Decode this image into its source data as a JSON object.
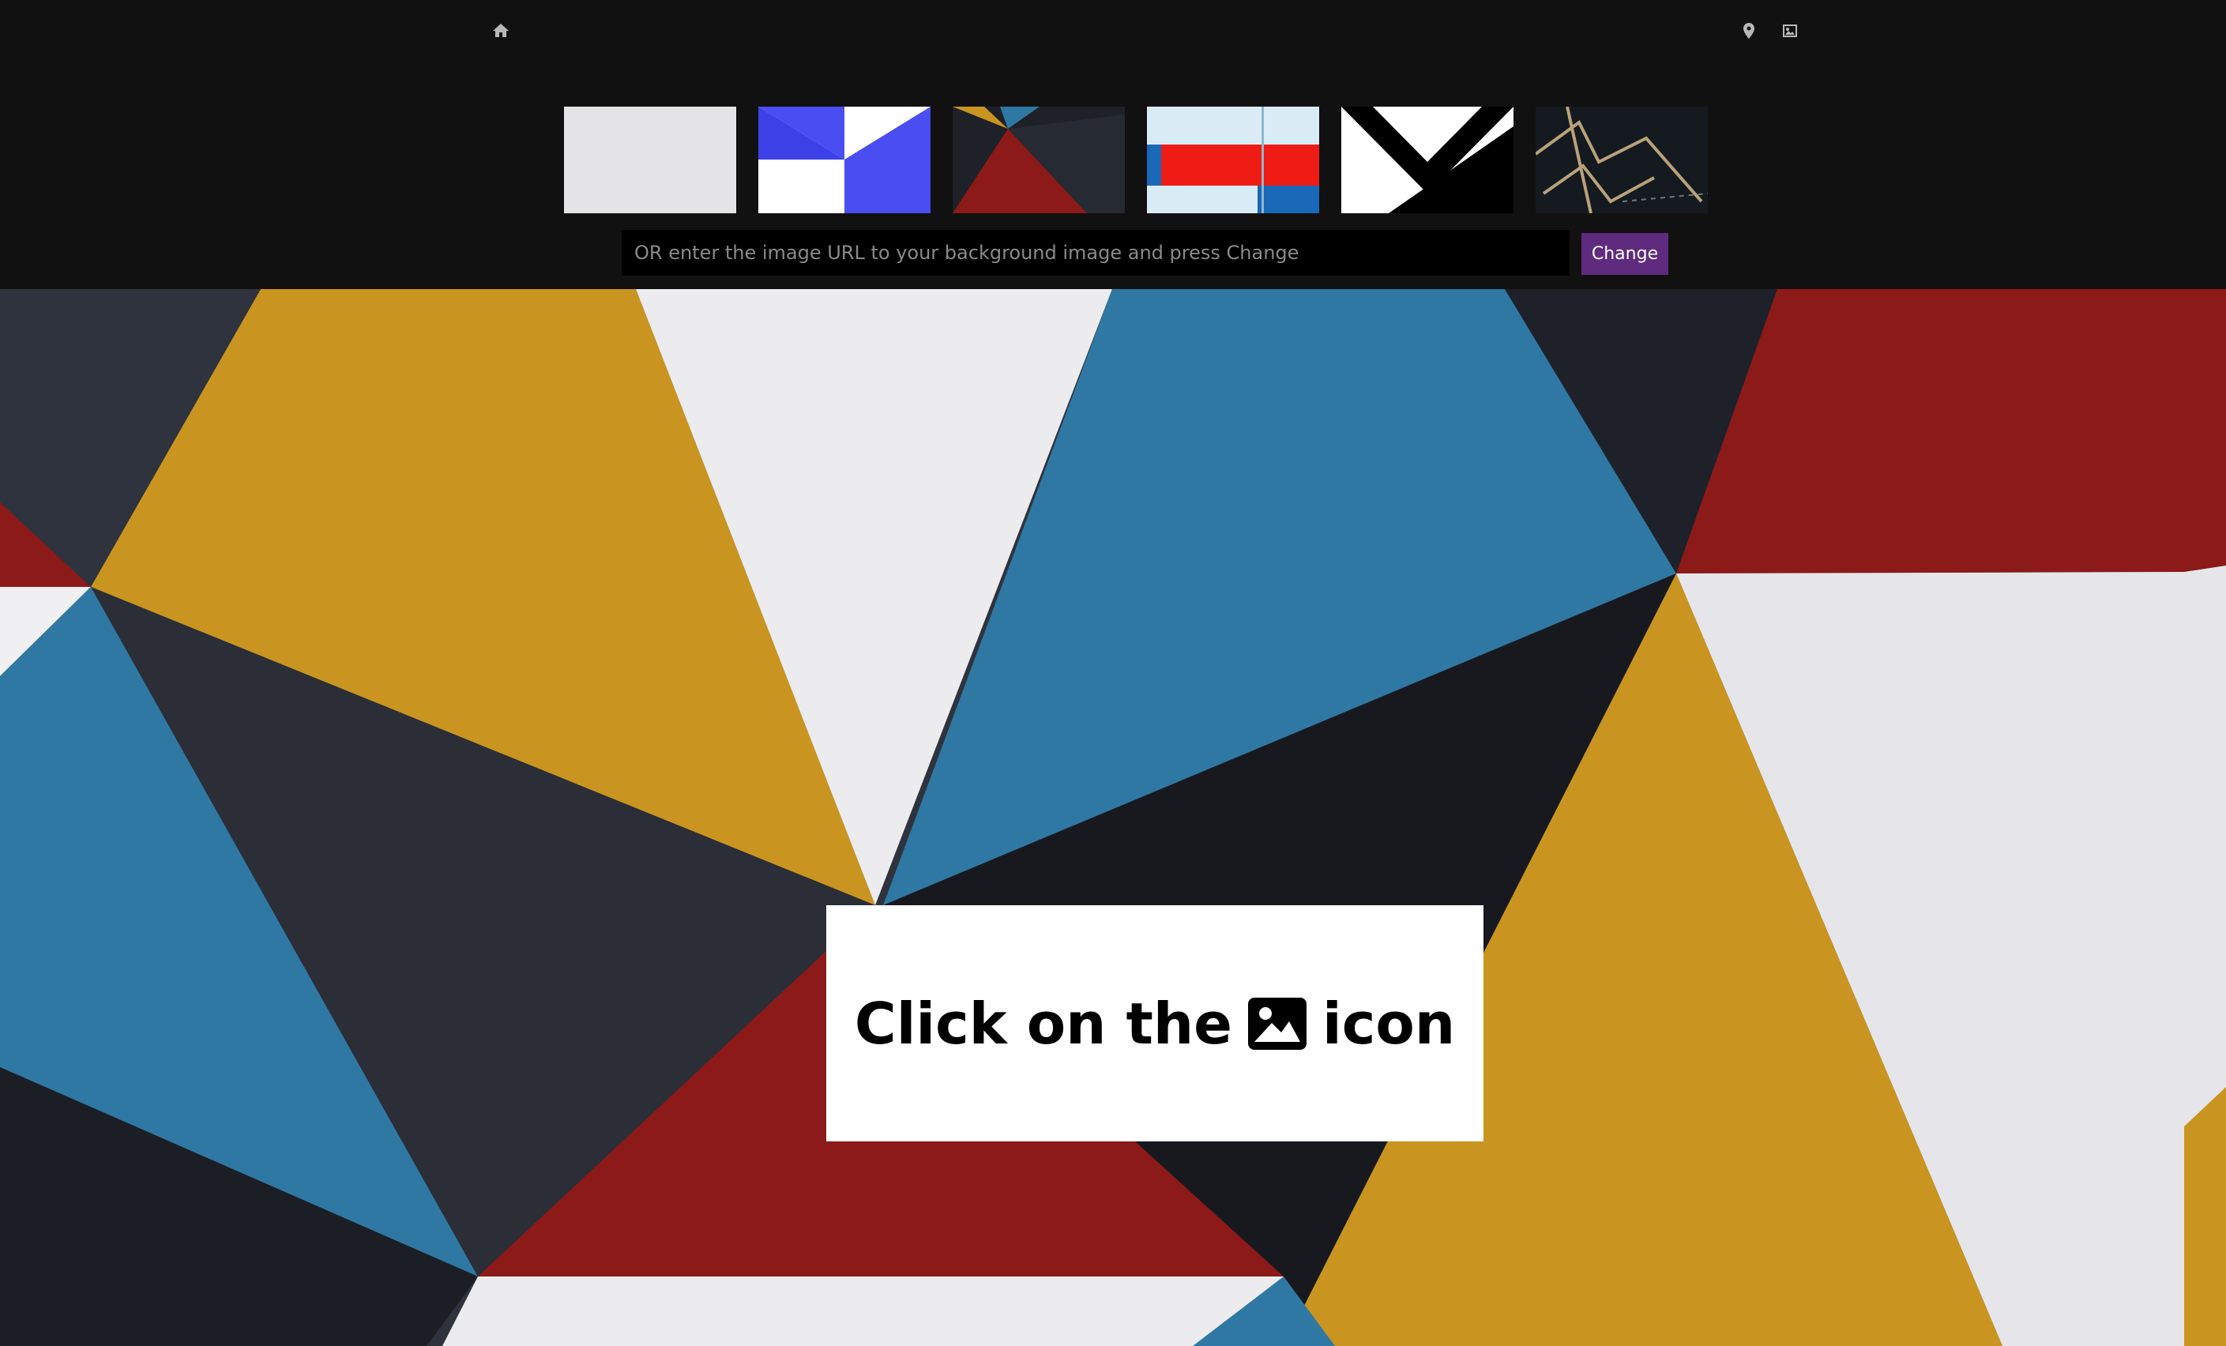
{
  "header": {
    "icons": {
      "home": "home-icon",
      "location": "map-pin-icon",
      "image": "image-icon"
    },
    "thumbnails": [
      {
        "name": "thumbnail-light-gray"
      },
      {
        "name": "thumbnail-blue-white-triangles"
      },
      {
        "name": "thumbnail-colored-triangles"
      },
      {
        "name": "thumbnail-red-blue-stripes"
      },
      {
        "name": "thumbnail-black-white-chevron"
      },
      {
        "name": "thumbnail-dark-lines"
      }
    ],
    "url_input": {
      "value": "",
      "placeholder": "OR enter the image URL to your background image and press Change"
    },
    "change_label": "Change"
  },
  "tip": {
    "before": "Click on the",
    "icon": "image-icon",
    "after": "icon"
  },
  "colors": {
    "topbar_bg": "#111111",
    "button_accent": "#5e2b7e",
    "mustard": "#c99520",
    "blue": "#2f78a3",
    "red": "#8b1a18",
    "navy": "#2f333d",
    "white": "#e8e8ea"
  }
}
